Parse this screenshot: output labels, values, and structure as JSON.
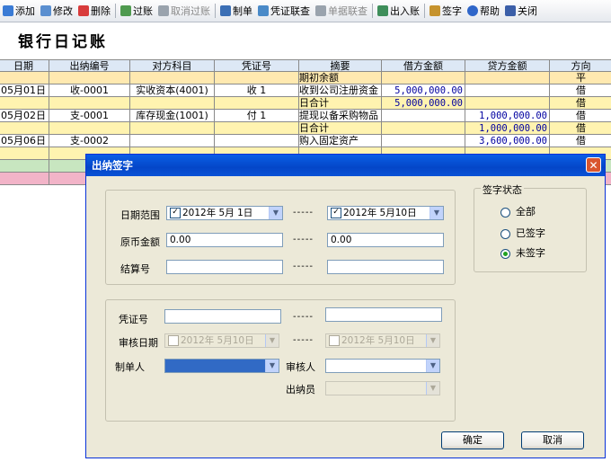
{
  "toolbar": {
    "items": [
      {
        "label": "添加",
        "color": "#3a7bd5"
      },
      {
        "label": "修改",
        "color": "#5a8fd0"
      },
      {
        "label": "删除",
        "color": "#d83b3b"
      },
      {
        "label": "过账",
        "color": "#4e9a4e"
      },
      {
        "label": "取消过账",
        "color": "#9aa3ad"
      },
      {
        "label": "制单",
        "color": "#3b6fb5"
      },
      {
        "label": "凭证联查",
        "color": "#4a8ac8"
      },
      {
        "label": "单据联查",
        "color": "#9aa3ad"
      },
      {
        "label": "出入账",
        "color": "#3e8e5a"
      },
      {
        "label": "签字",
        "color": "#c6932d"
      },
      {
        "label": "帮助",
        "color": "#2f66c9"
      },
      {
        "label": "关闭",
        "color": "#3b5fa8"
      }
    ]
  },
  "page": {
    "title": "银行日记账"
  },
  "table": {
    "headers": [
      "日期",
      "出纳编号",
      "对方科目",
      "凭证号",
      "摘要",
      "借方金额",
      "贷方金额",
      "方向"
    ],
    "rows": [
      {
        "date": "",
        "cashier_no": "",
        "account": "",
        "voucher": "",
        "summary": "期初余额",
        "debit": "",
        "credit": "",
        "dir": "平",
        "bg": "#ffe9b0"
      },
      {
        "date": "05月01日",
        "cashier_no": "收-0001",
        "account": "实收资本(4001)",
        "voucher": "收  1",
        "summary": "收到公司注册资金",
        "debit": "5,000,000.00",
        "credit": "",
        "dir": "借",
        "bg": "#ffffff"
      },
      {
        "date": "",
        "cashier_no": "",
        "account": "",
        "voucher": "",
        "summary": "日合计",
        "debit": "5,000,000.00",
        "credit": "",
        "dir": "借",
        "bg": "#fff3b0"
      },
      {
        "date": "05月02日",
        "cashier_no": "支-0001",
        "account": "库存现金(1001)",
        "voucher": "付  1",
        "summary": "提现以备采购物品",
        "debit": "",
        "credit": "1,000,000.00",
        "dir": "借",
        "bg": "#ffffff"
      },
      {
        "date": "",
        "cashier_no": "",
        "account": "",
        "voucher": "",
        "summary": "日合计",
        "debit": "",
        "credit": "1,000,000.00",
        "dir": "借",
        "bg": "#fff3b0"
      },
      {
        "date": "05月06日",
        "cashier_no": "支-0002",
        "account": "",
        "voucher": "",
        "summary": "购入固定资产",
        "debit": "",
        "credit": "3,600,000.00",
        "dir": "借",
        "bg": "#ffffff"
      },
      {
        "date": "",
        "cashier_no": "",
        "account": "",
        "voucher": "",
        "summary": "",
        "debit": "",
        "credit": "",
        "dir": "",
        "bg": "#fff3b0"
      },
      {
        "date": "",
        "cashier_no": "",
        "account": "",
        "voucher": "",
        "summary": "",
        "debit": "",
        "credit": "",
        "dir": "",
        "bg": "#c8e6c0"
      },
      {
        "date": "",
        "cashier_no": "",
        "account": "",
        "voucher": "",
        "summary": "",
        "debit": "",
        "credit": "",
        "dir": "",
        "bg": "#f2b4c8"
      }
    ]
  },
  "dialog": {
    "title": "出纳签字",
    "date_range_label": "日期范围",
    "date_from": "2012年 5月 1日",
    "date_to": "2012年 5月10日",
    "amount_label": "原币金额",
    "amount_from": "0.00",
    "amount_to": "0.00",
    "settle_label": "结算号",
    "voucher_label": "凭证号",
    "audit_date_label": "审核日期",
    "audit_date_from": "2012年 5月10日",
    "audit_date_to": "2012年 5月10日",
    "maker_label": "制单人",
    "auditor_label": "审核人",
    "cashier_label": "出纳员",
    "dash": "-----",
    "status_group_label": "签字状态",
    "status_options": [
      "全部",
      "已签字",
      "未签字"
    ],
    "status_selected": "未签字",
    "ok_label": "确定",
    "cancel_label": "取消",
    "close_glyph": "✕"
  }
}
